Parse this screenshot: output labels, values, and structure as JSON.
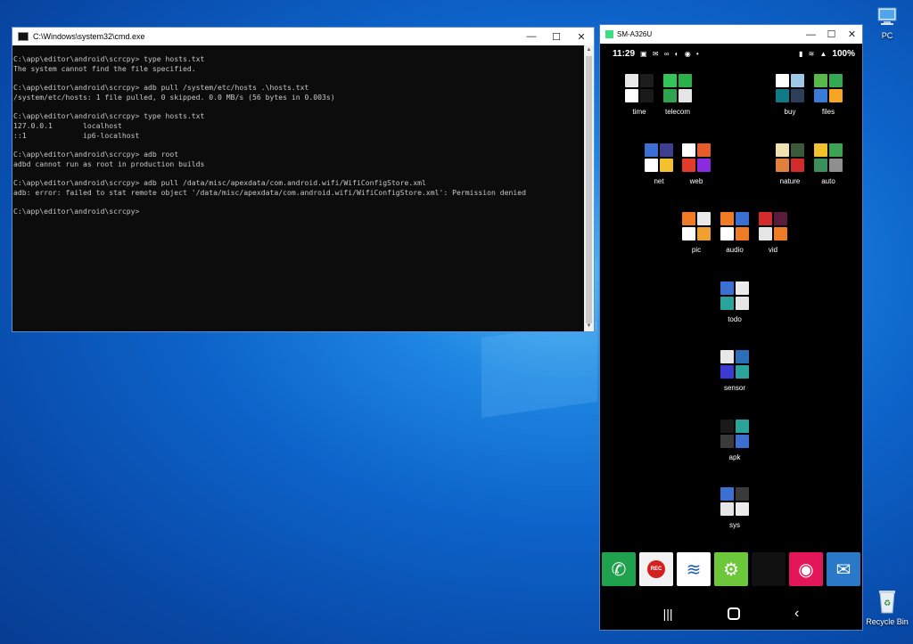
{
  "desktop": {
    "icons": [
      {
        "label": "PC"
      },
      {
        "label": "Recycle Bin"
      }
    ]
  },
  "cmd": {
    "title": "C:\\Windows\\system32\\cmd.exe",
    "lines": [
      "C:\\app\\editor\\android\\scrcpy> type hosts.txt",
      "The system cannot find the file specified.",
      "",
      "C:\\app\\editor\\android\\scrcpy> adb pull /system/etc/hosts .\\hosts.txt",
      "/system/etc/hosts: 1 file pulled, 0 skipped. 0.0 MB/s (56 bytes in 0.003s)",
      "",
      "C:\\app\\editor\\android\\scrcpy> type hosts.txt",
      "127.0.0.1       localhost",
      "::1             ip6-localhost",
      "",
      "C:\\app\\editor\\android\\scrcpy> adb root",
      "adbd cannot run as root in production builds",
      "",
      "C:\\app\\editor\\android\\scrcpy> adb pull /data/misc/apexdata/com.android.wifi/WifiConfigStore.xml",
      "adb: error: failed to stat remote object '/data/misc/apexdata/com.android.wifi/WifiConfigStore.xml': Permission denied",
      "",
      "C:\\app\\editor\\android\\scrcpy>"
    ]
  },
  "scrcpy": {
    "title": "SM-A326U",
    "status": {
      "time": "11:29",
      "battery": "100%"
    },
    "folders": [
      {
        "label": "time",
        "colors": [
          "#e8e8e8",
          "#1d1d1d",
          "#ffffff",
          "#1a1a1a"
        ]
      },
      {
        "label": "telecom",
        "colors": [
          "#33c559",
          "#2bb14a",
          "#2ea44f",
          "#e6e6e6"
        ]
      },
      {
        "label": "buy",
        "colors": [
          "#ffffff",
          "#9ec8e6",
          "#0f7b87",
          "#2d3e5a"
        ]
      },
      {
        "label": "files",
        "colors": [
          "#59b84a",
          "#35a853",
          "#3a7bd5",
          "#f6a623"
        ]
      },
      {
        "label": "net",
        "colors": [
          "#3b6fd1",
          "#3e3e8e",
          "#ffffff",
          "#f2c12e"
        ]
      },
      {
        "label": "web",
        "colors": [
          "#ffffff",
          "#e45d2a",
          "#e23b2e",
          "#8a2be2"
        ]
      },
      {
        "label": "nature",
        "colors": [
          "#f0e2b0",
          "#3a5a3a",
          "#e0803a",
          "#d22b2b"
        ]
      },
      {
        "label": "auto",
        "colors": [
          "#f2c12e",
          "#3ca450",
          "#3b8f5b",
          "#8f8f8f"
        ]
      },
      {
        "label": "pic",
        "colors": [
          "#f07b24",
          "#e8e8e8",
          "#ffffff",
          "#f0a030"
        ]
      },
      {
        "label": "audio",
        "colors": [
          "#f07b24",
          "#3b6fd1",
          "#ffffff",
          "#f07b24"
        ]
      },
      {
        "label": "vid",
        "colors": [
          "#d22b2b",
          "#5a1a3a",
          "#e6e6e6",
          "#f07b24"
        ]
      },
      {
        "label": "todo",
        "colors": [
          "#3b6fd1",
          "#ececec",
          "#2aa39a",
          "#e6e6e6"
        ]
      },
      {
        "label": "sensor",
        "colors": [
          "#e8e8e8",
          "#2b6fb8",
          "#3b3bd1",
          "#2aa39a"
        ]
      },
      {
        "label": "apk",
        "colors": [
          "#1a1a1a",
          "#2aa39a",
          "#3b3b3b",
          "#3b6fd1"
        ]
      },
      {
        "label": "sys",
        "colors": [
          "#3b6fd1",
          "#3a3a3a",
          "#e6e6e6",
          "#ececec"
        ]
      }
    ],
    "dock": [
      {
        "name": "phone-app",
        "color": "#1fa14e",
        "glyph": "✆",
        "label": ""
      },
      {
        "name": "rec-app",
        "color": "#f2f2f2",
        "glyph": "",
        "label": "REC"
      },
      {
        "name": "wifi-app",
        "color": "#ffffff",
        "glyph": "≋",
        "label": ""
      },
      {
        "name": "settings-app",
        "color": "#6cc73a",
        "glyph": "⚙",
        "label": ""
      },
      {
        "name": "tools-folder",
        "color": "#111111",
        "glyph": "",
        "label": ""
      },
      {
        "name": "camera-app",
        "color": "#e3165a",
        "glyph": "◉",
        "label": ""
      },
      {
        "name": "messages-app",
        "color": "#2a78c8",
        "glyph": "✉",
        "label": ""
      }
    ]
  }
}
